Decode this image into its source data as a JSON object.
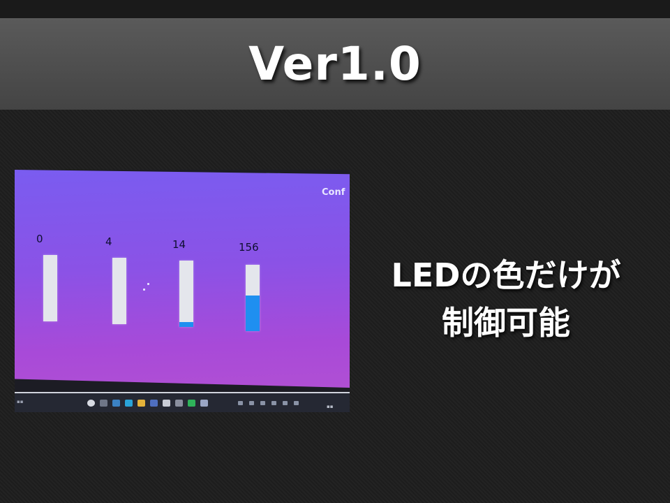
{
  "slide": {
    "title": "Ver1.0",
    "caption_lines": [
      "LEDの色だけが",
      "制御可能"
    ]
  },
  "screenshot": {
    "corner_label": "Conf",
    "leds": [
      {
        "value": "0",
        "fill_fraction": 0.0
      },
      {
        "value": "4",
        "fill_fraction": 0.0
      },
      {
        "value": "14",
        "fill_fraction": 0.07
      },
      {
        "value": "156",
        "fill_fraction": 0.54
      }
    ],
    "colors": {
      "screen_background": "#8b52e6",
      "led_off": "#e4e6ec",
      "led_fill": "#1f8ff0"
    },
    "taskbar_icons": [
      "windows-start-icon",
      "search-icon",
      "task-view-icon",
      "edge-icon",
      "explorer-icon",
      "store-icon",
      "mail-icon",
      "app-icon",
      "terminal-icon",
      "chrome-icon"
    ]
  }
}
